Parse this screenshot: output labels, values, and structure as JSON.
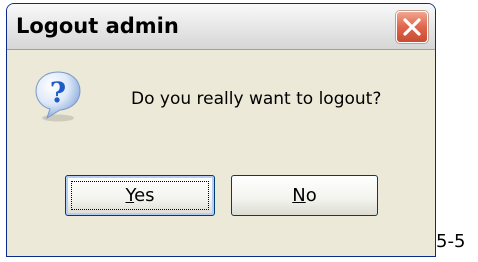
{
  "window": {
    "title": "Logout admin"
  },
  "dialog": {
    "message": "Do you really want to logout?",
    "icon": "question-icon"
  },
  "buttons": {
    "yes": {
      "mnemonic": "Y",
      "rest": "es"
    },
    "no": {
      "mnemonic": "N",
      "rest": "o"
    }
  },
  "caption": "5-5",
  "colors": {
    "dialog_bg": "#ece9d8",
    "close_button": "#e0654a",
    "icon_blue": "#1c5cc7",
    "button_border": "#003c74"
  }
}
